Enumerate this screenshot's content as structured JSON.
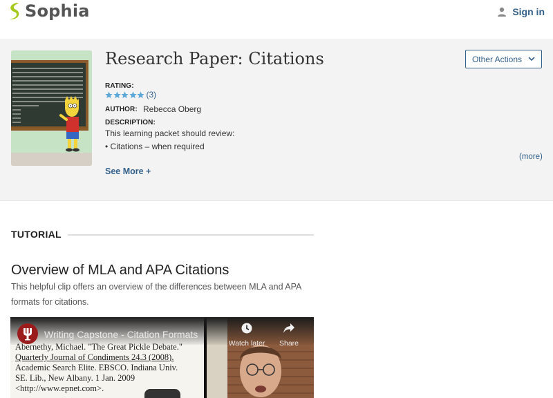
{
  "header": {
    "brand": "Sophia",
    "signin_label": "Sign in"
  },
  "packet": {
    "title": "Research Paper: Citations",
    "other_actions_label": "Other Actions",
    "rating_label": "RATING:",
    "rating_value": 5,
    "rating_count": "(3)",
    "author_label": "AUTHOR:",
    "author_name": "Rebecca Oberg",
    "description_label": "DESCRIPTION:",
    "description_line1": "This learning packet should review:",
    "description_line2": "• Citations – when required",
    "more_label": "(more)",
    "see_more_label": "See More +"
  },
  "tutorial": {
    "section_label": "TUTORIAL",
    "title": "Overview of MLA and APA Citations",
    "description": "This helpful clip offers an overview of the differences between MLA and APA formats for citations."
  },
  "video": {
    "title": "Writing Capstone - Citation Formats",
    "watch_later_label": "Watch later",
    "share_label": "Share",
    "citation_line1": "Abernethy, Michael. \"The Great Pickle Debate.\"",
    "citation_line2": "Quarterly Journal of Condiments 24.3 (2008).",
    "citation_line3": "Academic Search Elite. EBSCO. Indiana Univ.",
    "citation_line4": "SE. Lib., New Albany. 1 Jan. 2009",
    "citation_line5": "<http://www.epnet.com>."
  },
  "colors": {
    "link": "#33618b",
    "brand_green": "#a5c81d",
    "panel_bg": "#f3f3f3",
    "star": "#5ba7d8"
  },
  "icons": {
    "logo": "sophia-logo-icon",
    "signin": "user-icon",
    "dropdown": "chevron-down-icon",
    "rating": "star-icon",
    "watch_later": "clock-icon",
    "share": "share-arrow-icon"
  }
}
